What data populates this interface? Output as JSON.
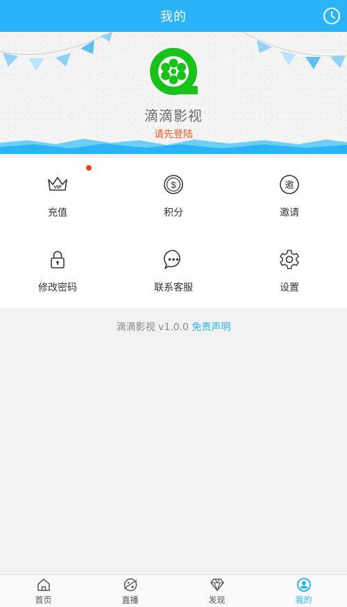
{
  "header": {
    "title": "我的",
    "history_icon": "clock-icon"
  },
  "profile": {
    "app_name": "滴滴影视",
    "login_prompt": "请先登陆",
    "logo_icon": "film-reel-logo-icon"
  },
  "menu": {
    "items": [
      {
        "label": "充值",
        "icon": "vip-crown-icon",
        "badge_dot": true
      },
      {
        "label": "积分",
        "icon": "coin-icon"
      },
      {
        "label": "邀请",
        "icon": "invite-icon"
      },
      {
        "label": "修改密码",
        "icon": "lock-icon"
      },
      {
        "label": "联系客服",
        "icon": "chat-bubble-icon"
      },
      {
        "label": "设置",
        "icon": "gear-icon"
      }
    ]
  },
  "footer": {
    "version_text": "滴滴影视 v1.0.0",
    "disclaimer_link": "免责声明"
  },
  "tabbar": {
    "tabs": [
      {
        "label": "首页",
        "icon": "home-icon"
      },
      {
        "label": "直播",
        "icon": "live-planet-icon"
      },
      {
        "label": "发现",
        "icon": "diamond-icon"
      },
      {
        "label": "我的",
        "icon": "user-icon",
        "active": true
      }
    ]
  },
  "colors": {
    "primary": "#2ab3f6",
    "login_prompt": "#ff5a1f",
    "logo_green": "#19c21a",
    "badge_red": "#ff3b1f"
  }
}
